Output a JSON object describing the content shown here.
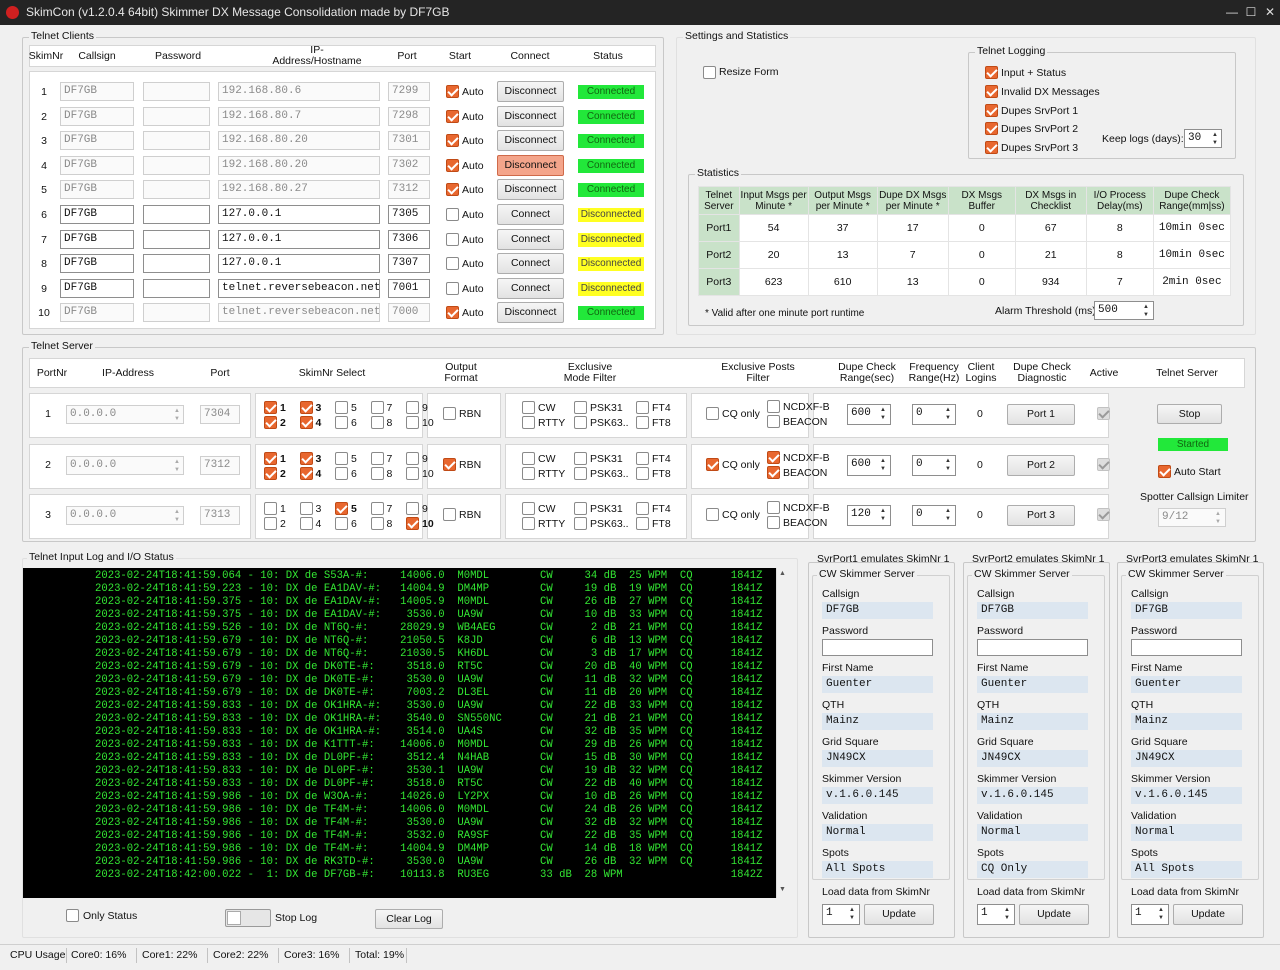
{
  "window": {
    "title": "SkimCon (v1.2.0.4 64bit) Skimmer DX Message Consolidation made by DF7GB",
    "min": "—",
    "max": "☐",
    "close": "✕"
  },
  "telnet_clients": {
    "group_label": "Telnet Clients",
    "headers": [
      "SkimNr",
      "Callsign",
      "Password",
      "IP-Address/Hostname",
      "Port",
      "Start",
      "Connect",
      "Status"
    ],
    "rows": [
      {
        "nr": "1",
        "callsign": "DF7GB",
        "ip": "192.168.80.6",
        "port": "7299",
        "auto": true,
        "connect": "Disconnect",
        "status": "Connected",
        "enabled": false
      },
      {
        "nr": "2",
        "callsign": "DF7GB",
        "ip": "192.168.80.7",
        "port": "7298",
        "auto": true,
        "connect": "Disconnect",
        "status": "Connected",
        "enabled": false
      },
      {
        "nr": "3",
        "callsign": "DF7GB",
        "ip": "192.168.80.20",
        "port": "7301",
        "auto": true,
        "connect": "Disconnect",
        "status": "Connected",
        "enabled": false
      },
      {
        "nr": "4",
        "callsign": "DF7GB",
        "ip": "192.168.80.20",
        "port": "7302",
        "auto": true,
        "connect": "Disconnect",
        "status": "Connected",
        "enabled": false
      },
      {
        "nr": "5",
        "callsign": "DF7GB",
        "ip": "192.168.80.27",
        "port": "7312",
        "auto": true,
        "connect": "Disconnect",
        "status": "Connected",
        "enabled": false
      },
      {
        "nr": "6",
        "callsign": "DF7GB",
        "ip": "127.0.0.1",
        "port": "7305",
        "auto": false,
        "connect": "Connect",
        "status": "Disconnected",
        "enabled": true
      },
      {
        "nr": "7",
        "callsign": "DF7GB",
        "ip": "127.0.0.1",
        "port": "7306",
        "auto": false,
        "connect": "Connect",
        "status": "Disconnected",
        "enabled": true
      },
      {
        "nr": "8",
        "callsign": "DF7GB",
        "ip": "127.0.0.1",
        "port": "7307",
        "auto": false,
        "connect": "Connect",
        "status": "Disconnected",
        "enabled": true
      },
      {
        "nr": "9",
        "callsign": "DF7GB",
        "ip": "telnet.reversebeacon.net",
        "port": "7001",
        "auto": false,
        "connect": "Connect",
        "status": "Disconnected",
        "enabled": true
      },
      {
        "nr": "10",
        "callsign": "DF7GB",
        "ip": "telnet.reversebeacon.net",
        "port": "7000",
        "auto": true,
        "connect": "Disconnect",
        "status": "Connected",
        "enabled": false
      }
    ],
    "auto_label": "Auto"
  },
  "settings": {
    "group_label": "Settings and Statistics",
    "resize_form": "Resize Form",
    "telnet_logging": {
      "label": "Telnet Logging",
      "items": [
        "Input + Status",
        "Invalid DX Messages",
        "Dupes SrvPort 1",
        "Dupes SrvPort 2",
        "Dupes SrvPort 3"
      ],
      "keep_logs_label": "Keep logs (days):",
      "keep_logs_value": "30"
    },
    "statistics": {
      "label": "Statistics",
      "headers": [
        "Telnet Server",
        "Input Msgs per Minute *",
        "Output Msgs per Minute *",
        "Dupe DX Msgs per Minute *",
        "DX Msgs Buffer",
        "DX Msgs in Checklist",
        "I/O Process Delay(ms)",
        "Dupe Check Range(mm|ss)"
      ],
      "rows": [
        [
          "Port1",
          "54",
          "37",
          "17",
          "0",
          "67",
          "8",
          "10min 0sec"
        ],
        [
          "Port2",
          "20",
          "13",
          "7",
          "0",
          "21",
          "8",
          "10min 0sec"
        ],
        [
          "Port3",
          "623",
          "610",
          "13",
          "0",
          "934",
          "7",
          "2min 0sec"
        ]
      ],
      "note": "* Valid after one minute port runtime",
      "alarm_label": "Alarm Threshold (ms)",
      "alarm_value": "500"
    }
  },
  "telnet_server": {
    "group_label": "Telnet Server",
    "headers": [
      "PortNr",
      "IP-Address",
      "Port",
      "SkimNr Select",
      "Output Format",
      "Exclusive Mode Filter",
      "Exclusive Posts Filter",
      "Dupe Check Range(sec)",
      "Frequency Range(Hz)",
      "Client Logins",
      "Dupe Check Diagnostic",
      "Active",
      "Telnet Server"
    ],
    "rows": [
      {
        "nr": "1",
        "ip": "0.0.0.0",
        "port": "7304",
        "skim": [
          true,
          true,
          true,
          true,
          false,
          false,
          false,
          false,
          false,
          false
        ],
        "rbn": false,
        "cw": false,
        "rtty": false,
        "psk31": false,
        "psk63": false,
        "ft4": false,
        "ft8": false,
        "cq_only": false,
        "ncdxf": false,
        "beacon": false,
        "dupe": "600",
        "freq": "0",
        "logins": "0",
        "diag": "Port 1"
      },
      {
        "nr": "2",
        "ip": "0.0.0.0",
        "port": "7312",
        "skim": [
          true,
          true,
          true,
          true,
          false,
          false,
          false,
          false,
          false,
          false
        ],
        "rbn": true,
        "cw": false,
        "rtty": false,
        "psk31": false,
        "psk63": false,
        "ft4": false,
        "ft8": false,
        "cq_only": true,
        "ncdxf": true,
        "beacon": true,
        "dupe": "600",
        "freq": "0",
        "logins": "0",
        "diag": "Port 2"
      },
      {
        "nr": "3",
        "ip": "0.0.0.0",
        "port": "7313",
        "skim": [
          false,
          false,
          false,
          false,
          true,
          false,
          false,
          false,
          false,
          true
        ],
        "rbn": false,
        "cw": false,
        "rtty": false,
        "psk31": false,
        "psk63": false,
        "ft4": false,
        "ft8": false,
        "cq_only": false,
        "ncdxf": false,
        "beacon": false,
        "dupe": "120",
        "freq": "0",
        "logins": "0",
        "diag": "Port 3"
      }
    ],
    "labels": {
      "rbn": "RBN",
      "cw": "CW",
      "rtty": "RTTY",
      "psk31": "PSK31",
      "psk63": "PSK63..",
      "ft4": "FT4",
      "ft8": "FT8",
      "cq_only": "CQ only",
      "ncdxf": "NCDXF-B",
      "beacon": "BEACON"
    },
    "stop_btn": "Stop",
    "started": "Started",
    "auto_start": "Auto Start",
    "limiter_label": "Spotter Callsign Limiter",
    "limiter_value": "9/12"
  },
  "log": {
    "group_label": "Telnet Input Log and I/O Status",
    "lines": [
      "2023-02-24T18:41:59.064 - 10: DX de S53A-#:     14006.0  M0MDL        CW     34 dB  25 WPM  CQ      1841Z",
      "2023-02-24T18:41:59.223 - 10: DX de EA1DAV-#:   14004.9  DM4MP        CW     19 dB  19 WPM  CQ      1841Z",
      "2023-02-24T18:41:59.375 - 10: DX de EA1DAV-#:   14005.9  M0MDL        CW     26 dB  27 WPM  CQ      1841Z",
      "2023-02-24T18:41:59.375 - 10: DX de EA1DAV-#:    3530.0  UA9W         CW     10 dB  33 WPM  CQ      1841Z",
      "2023-02-24T18:41:59.526 - 10: DX de NT6Q-#:     28029.9  WB4AEG       CW      2 dB  21 WPM  CQ      1841Z",
      "2023-02-24T18:41:59.679 - 10: DX de NT6Q-#:     21050.5  K8JD         CW      6 dB  13 WPM  CQ      1841Z",
      "2023-02-24T18:41:59.679 - 10: DX de NT6Q-#:     21030.5  KH6DL        CW      3 dB  17 WPM  CQ      1841Z",
      "2023-02-24T18:41:59.679 - 10: DX de DK0TE-#:     3518.0  RT5C         CW     20 dB  40 WPM  CQ      1841Z",
      "2023-02-24T18:41:59.679 - 10: DX de DK0TE-#:     3530.0  UA9W         CW     11 dB  32 WPM  CQ      1841Z",
      "2023-02-24T18:41:59.679 - 10: DX de DK0TE-#:     7003.2  DL3EL        CW     11 dB  20 WPM  CQ      1841Z",
      "2023-02-24T18:41:59.833 - 10: DX de OK1HRA-#:    3530.0  UA9W         CW     22 dB  33 WPM  CQ      1841Z",
      "2023-02-24T18:41:59.833 - 10: DX de OK1HRA-#:    3540.0  SN550NC      CW     21 dB  21 WPM  CQ      1841Z",
      "2023-02-24T18:41:59.833 - 10: DX de OK1HRA-#:    3514.0  UA4S         CW     32 dB  35 WPM  CQ      1841Z",
      "2023-02-24T18:41:59.833 - 10: DX de K1TTT-#:    14006.0  M0MDL        CW     29 dB  26 WPM  CQ      1841Z",
      "2023-02-24T18:41:59.833 - 10: DX de DL0PF-#:     3512.4  N4HAB        CW     15 dB  30 WPM  CQ      1841Z",
      "2023-02-24T18:41:59.833 - 10: DX de DL0PF-#:     3530.1  UA9W         CW     19 dB  32 WPM  CQ      1841Z",
      "2023-02-24T18:41:59.833 - 10: DX de DL0PF-#:     3518.0  RT5C         CW     22 dB  40 WPM  CQ      1841Z",
      "2023-02-24T18:41:59.986 - 10: DX de W3OA-#:     14026.0  LY2PX        CW     10 dB  26 WPM  CQ      1841Z",
      "2023-02-24T18:41:59.986 - 10: DX de TF4M-#:     14006.0  M0MDL        CW     24 dB  26 WPM  CQ      1841Z",
      "2023-02-24T18:41:59.986 - 10: DX de TF4M-#:      3530.0  UA9W         CW     32 dB  32 WPM  CQ      1841Z",
      "2023-02-24T18:41:59.986 - 10: DX de TF4M-#:      3532.0  RA9SF        CW     22 dB  35 WPM  CQ      1841Z",
      "2023-02-24T18:41:59.986 - 10: DX de TF4M-#:     14004.9  DM4MP        CW     14 dB  18 WPM  CQ      1841Z",
      "2023-02-24T18:41:59.986 - 10: DX de RK3TD-#:     3530.0  UA9W         CW     26 dB  32 WPM  CQ      1841Z",
      "2023-02-24T18:42:00.022 -  1: DX de DF7GB-#:    10113.8  RU3EG        33 dB  28 WPM                 1842Z"
    ],
    "only_status": "Only Status",
    "stop_log": "Stop Log",
    "clear_log": "Clear Log"
  },
  "svr_ports": [
    {
      "title": "SvrPort1 emulates SkimNr  1",
      "group": "CW Skimmer Server",
      "callsign": "DF7GB",
      "password": "",
      "first_name": "Guenter",
      "qth": "Mainz",
      "grid": "JN49CX",
      "version": "v.1.6.0.145",
      "validation": "Normal",
      "spots": "All Spots",
      "load_label": "Load data from SkimNr",
      "load_value": "1",
      "update": "Update"
    },
    {
      "title": "SvrPort2 emulates SkimNr  1",
      "group": "CW Skimmer Server",
      "callsign": "DF7GB",
      "password": "",
      "first_name": "Guenter",
      "qth": "Mainz",
      "grid": "JN49CX",
      "version": "v.1.6.0.145",
      "validation": "Normal",
      "spots": "CQ Only",
      "load_label": "Load data from SkimNr",
      "load_value": "1",
      "update": "Update"
    },
    {
      "title": "SvrPort3 emulates SkimNr  1",
      "group": "CW Skimmer Server",
      "callsign": "DF7GB",
      "password": "",
      "first_name": "Guenter",
      "qth": "Mainz",
      "grid": "JN49CX",
      "version": "v.1.6.0.145",
      "validation": "Normal",
      "spots": "All Spots",
      "load_label": "Load data from SkimNr",
      "load_value": "1",
      "update": "Update"
    }
  ],
  "svr_field_labels": {
    "callsign": "Callsign",
    "password": "Password",
    "first_name": "First Name",
    "qth": "QTH",
    "grid": "Grid Square",
    "version": "Skimmer Version",
    "validation": "Validation",
    "spots": "Spots"
  },
  "statusbar": {
    "cpu": "CPU Usage",
    "core0": "Core0: 16%",
    "core1": "Core1: 22%",
    "core2": "Core2: 22%",
    "core3": "Core3: 16%",
    "total": "Total: 19%"
  }
}
